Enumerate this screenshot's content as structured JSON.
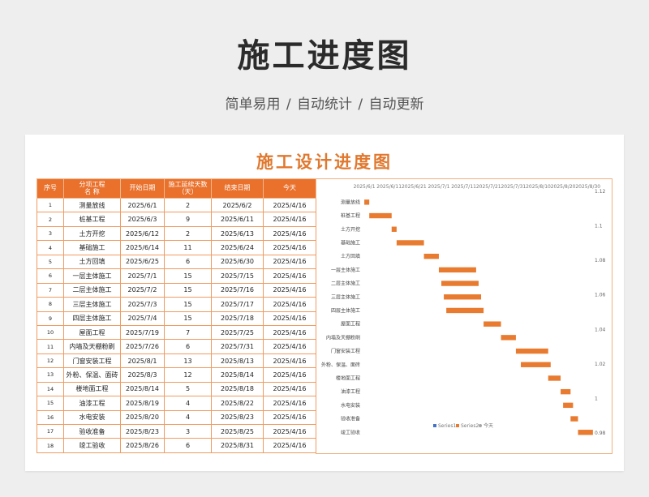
{
  "header": {
    "title": "施工进度图",
    "subtitle": "简单易用 / 自动统计 / 自动更新"
  },
  "sheet": {
    "title": "施工设计进度图"
  },
  "table": {
    "headers": [
      "序号",
      "分项工程\n名 称",
      "开始日期",
      "施工延续天数（天）",
      "结束日期",
      "今天"
    ],
    "rows": [
      [
        "1",
        "测量放线",
        "2025/6/1",
        "2",
        "2025/6/2",
        "2025/4/16"
      ],
      [
        "2",
        "桩基工程",
        "2025/6/3",
        "9",
        "2025/6/11",
        "2025/4/16"
      ],
      [
        "3",
        "土方开挖",
        "2025/6/12",
        "2",
        "2025/6/13",
        "2025/4/16"
      ],
      [
        "4",
        "基础施工",
        "2025/6/14",
        "11",
        "2025/6/24",
        "2025/4/16"
      ],
      [
        "5",
        "土方回填",
        "2025/6/25",
        "6",
        "2025/6/30",
        "2025/4/16"
      ],
      [
        "6",
        "一层主体施工",
        "2025/7/1",
        "15",
        "2025/7/15",
        "2025/4/16"
      ],
      [
        "7",
        "二层主体施工",
        "2025/7/2",
        "15",
        "2025/7/16",
        "2025/4/16"
      ],
      [
        "8",
        "三层主体施工",
        "2025/7/3",
        "15",
        "2025/7/17",
        "2025/4/16"
      ],
      [
        "9",
        "四层主体施工",
        "2025/7/4",
        "15",
        "2025/7/18",
        "2025/4/16"
      ],
      [
        "10",
        "屋面工程",
        "2025/7/19",
        "7",
        "2025/7/25",
        "2025/4/16"
      ],
      [
        "11",
        "内墙及天棚粉刷",
        "2025/7/26",
        "6",
        "2025/7/31",
        "2025/4/16"
      ],
      [
        "12",
        "门窗安装工程",
        "2025/8/1",
        "13",
        "2025/8/13",
        "2025/4/16"
      ],
      [
        "13",
        "外粉、保温、面砖",
        "2025/8/3",
        "12",
        "2025/8/14",
        "2025/4/16"
      ],
      [
        "14",
        "楼地面工程",
        "2025/8/14",
        "5",
        "2025/8/18",
        "2025/4/16"
      ],
      [
        "15",
        "油漆工程",
        "2025/8/19",
        "4",
        "2025/8/22",
        "2025/4/16"
      ],
      [
        "16",
        "水电安装",
        "2025/8/20",
        "4",
        "2025/8/23",
        "2025/4/16"
      ],
      [
        "17",
        "验收准备",
        "2025/8/23",
        "3",
        "2025/8/25",
        "2025/4/16"
      ],
      [
        "18",
        "竣工验收",
        "2025/8/26",
        "6",
        "2025/8/31",
        "2025/4/16"
      ]
    ]
  },
  "colors": {
    "accent": "#e9712c",
    "bar": "#e87b2f",
    "title": "#e0782e"
  },
  "chart_data": {
    "type": "bar",
    "orientation": "horizontal-gantt",
    "x_tick_labels": [
      "2025/6/1",
      "2025/6/11",
      "2025/6/21",
      "2025/7/1",
      "2025/7/11",
      "2025/7/21",
      "2025/7/31",
      "2025/8/10",
      "2025/8/20",
      "2025/8/30"
    ],
    "xlim": [
      "2025/5/31",
      "2025/9/3"
    ],
    "categories": [
      "测量放线",
      "桩基工程",
      "土方开挖",
      "基础施工",
      "土方回填",
      "一层主体施工",
      "二层主体施工",
      "三层主体施工",
      "四层主体施工",
      "屋面工程",
      "内墙及天棚粉刷",
      "门窗安装工程",
      "外粉、保温、面砖",
      "楼地面工程",
      "油漆工程",
      "水电安装",
      "验收准备",
      "竣工验收"
    ],
    "starts": [
      "2025/6/1",
      "2025/6/3",
      "2025/6/12",
      "2025/6/14",
      "2025/6/25",
      "2025/7/1",
      "2025/7/2",
      "2025/7/3",
      "2025/7/4",
      "2025/7/19",
      "2025/7/26",
      "2025/8/1",
      "2025/8/3",
      "2025/8/14",
      "2025/8/19",
      "2025/8/20",
      "2025/8/23",
      "2025/8/26"
    ],
    "durations": [
      2,
      9,
      2,
      11,
      6,
      15,
      15,
      15,
      15,
      7,
      6,
      13,
      12,
      5,
      4,
      4,
      3,
      6
    ],
    "y2_tick_labels": [
      "1.12",
      "1.1",
      "1.08",
      "1.06",
      "1.04",
      "1.02",
      "1",
      "0.98"
    ],
    "y2lim": [
      0.98,
      1.12
    ],
    "legend": [
      "Series1",
      "Series2",
      "今天"
    ],
    "legend_position": "bottom-center"
  }
}
